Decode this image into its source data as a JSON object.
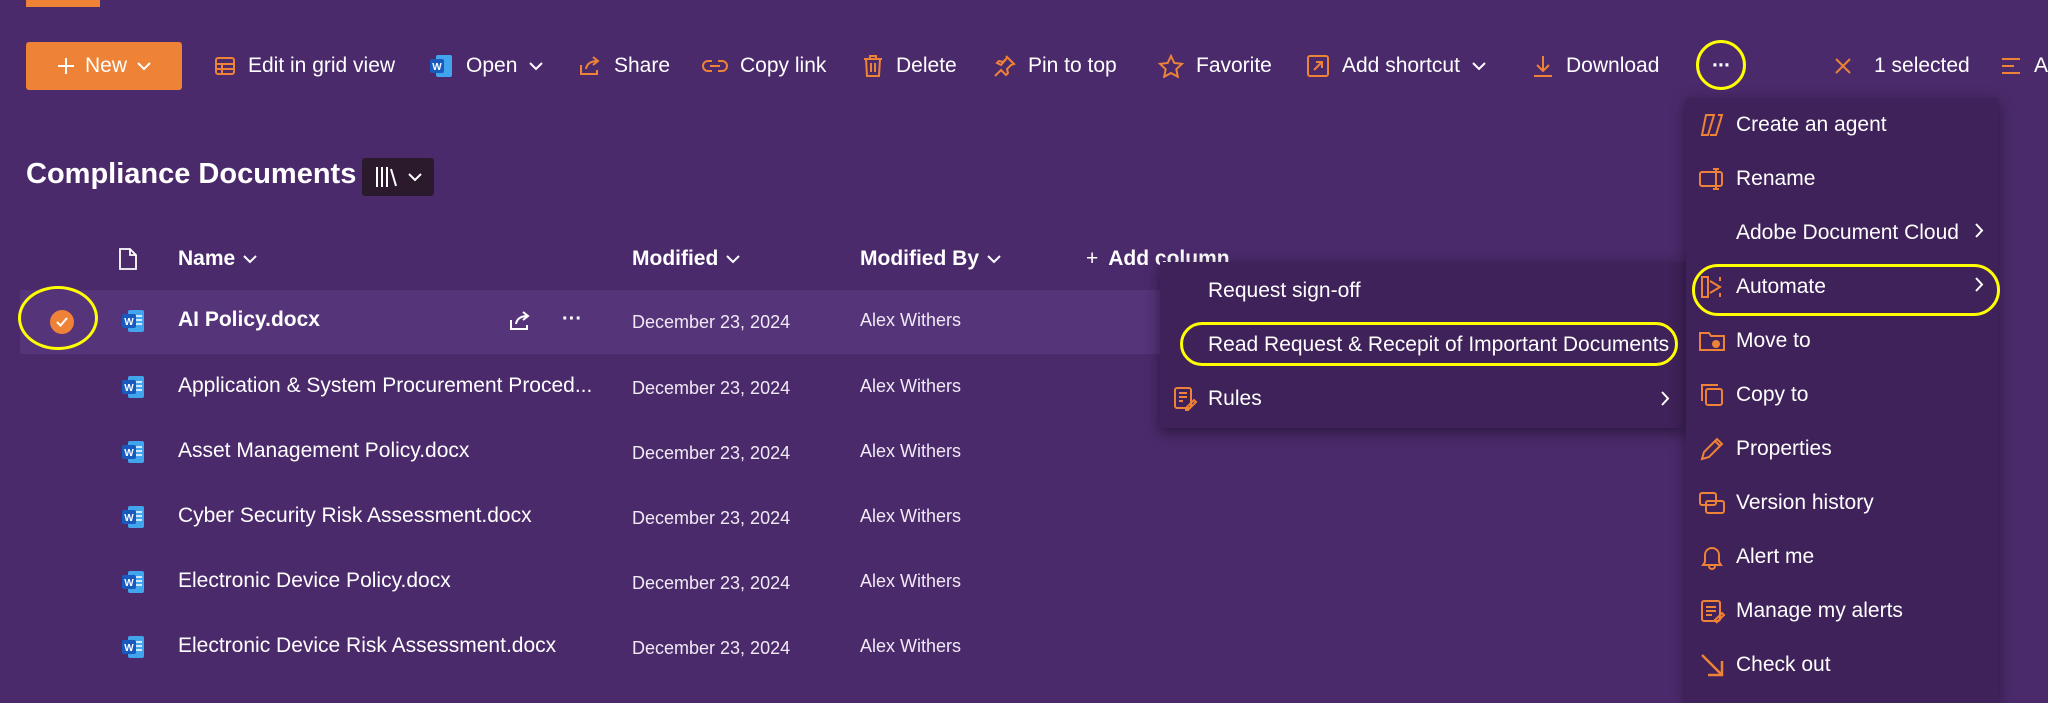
{
  "commandbar": {
    "new_label": "New",
    "edit_grid_label": "Edit in grid view",
    "open_label": "Open",
    "share_label": "Share",
    "copy_link_label": "Copy link",
    "delete_label": "Delete",
    "pin_label": "Pin to top",
    "favorite_label": "Favorite",
    "add_shortcut_label": "Add shortcut",
    "download_label": "Download",
    "more_label": "···",
    "selected_label": "1 selected",
    "overflow_label": "A"
  },
  "page": {
    "title": "Compliance Documents"
  },
  "table": {
    "headers": {
      "name": "Name",
      "modified": "Modified",
      "modified_by": "Modified By",
      "add_column": "Add column"
    },
    "rows": [
      {
        "name": "AI Policy.docx",
        "modified": "December 23, 2024",
        "modified_by": "Alex Withers"
      },
      {
        "name": "Application & System Procurement Proced...",
        "modified": "December 23, 2024",
        "modified_by": "Alex Withers"
      },
      {
        "name": "Asset Management Policy.docx",
        "modified": "December 23, 2024",
        "modified_by": "Alex Withers"
      },
      {
        "name": "Cyber Security Risk Assessment.docx",
        "modified": "December 23, 2024",
        "modified_by": "Alex Withers"
      },
      {
        "name": "Electronic Device Policy.docx",
        "modified": "December 23, 2024",
        "modified_by": "Alex Withers"
      },
      {
        "name": "Electronic Device Risk Assessment.docx",
        "modified": "December 23, 2024",
        "modified_by": "Alex Withers"
      }
    ]
  },
  "submenu": {
    "items": [
      {
        "label": "Request sign-off"
      },
      {
        "label": "Read Request & Recepit of Important Documents"
      },
      {
        "label": "Rules"
      }
    ]
  },
  "menu": {
    "items": [
      {
        "label": "Create an agent"
      },
      {
        "label": "Rename"
      },
      {
        "label": "Adobe Document Cloud"
      },
      {
        "label": "Automate"
      },
      {
        "label": "Move to"
      },
      {
        "label": "Copy to"
      },
      {
        "label": "Properties"
      },
      {
        "label": "Version history"
      },
      {
        "label": "Alert me"
      },
      {
        "label": "Manage my alerts"
      },
      {
        "label": "Check out"
      }
    ]
  },
  "colors": {
    "background": "#4b2a6b",
    "accent": "#ee8236",
    "menu": "#3f2259",
    "highlight": "#ffff00"
  }
}
